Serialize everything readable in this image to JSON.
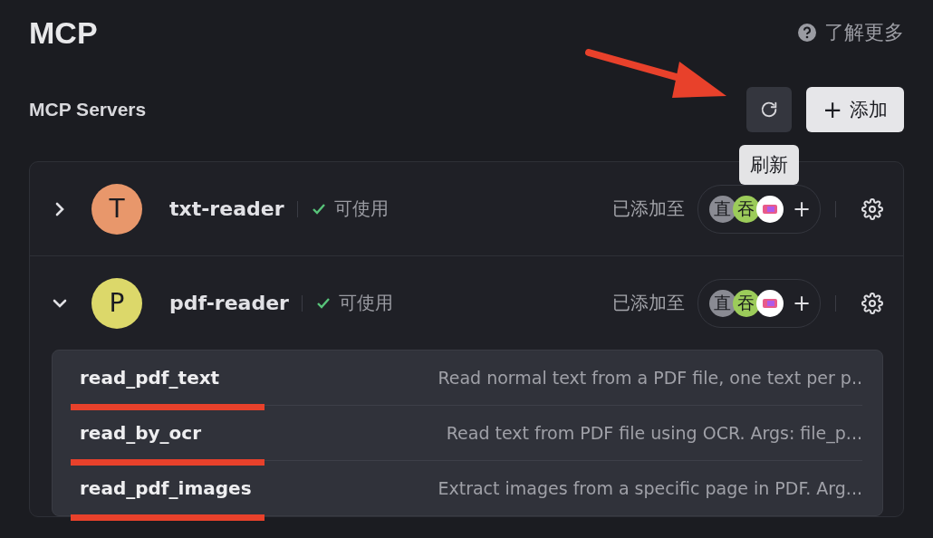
{
  "title": "MCP",
  "help_link": "了解更多",
  "section": {
    "title": "MCP Servers",
    "refresh_tooltip": "刷新",
    "add_button": {
      "icon": "+",
      "label": "添加"
    }
  },
  "servers": [
    {
      "letter": "T",
      "name": "txt-reader",
      "color": "#e8976b",
      "status": "可使用",
      "expanded": false,
      "added_label": "已添加至",
      "agents": [
        {
          "kind": "text",
          "label": "直",
          "color": "#8a8b93"
        },
        {
          "kind": "text",
          "label": "吞",
          "color": "#9ccc5a"
        },
        {
          "kind": "picture",
          "color": "#ffffff"
        }
      ],
      "add_icon": "+"
    },
    {
      "letter": "P",
      "name": "pdf-reader",
      "color": "#dcd86a",
      "status": "可使用",
      "expanded": true,
      "added_label": "已添加至",
      "agents": [
        {
          "kind": "text",
          "label": "直",
          "color": "#8a8b93"
        },
        {
          "kind": "text",
          "label": "吞",
          "color": "#9ccc5a"
        },
        {
          "kind": "picture",
          "color": "#ffffff"
        }
      ],
      "add_icon": "+",
      "tools": [
        {
          "name": "read_pdf_text",
          "description": "Read normal text from a PDF file, one text per p.."
        },
        {
          "name": "read_by_ocr",
          "description": "Read text from PDF file using OCR. Args: file_p..."
        },
        {
          "name": "read_pdf_images",
          "description": "Extract images from a specific page in PDF. Arg..."
        }
      ]
    }
  ]
}
